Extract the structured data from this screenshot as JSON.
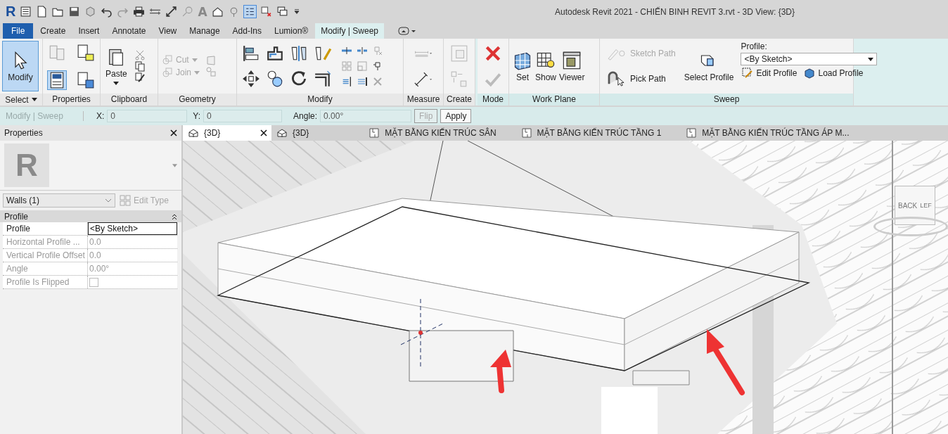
{
  "window": {
    "title": "Autodesk Revit 2021 - CHIẾN BINH REVIT 3.rvt - 3D View: {3D}"
  },
  "quick_access": {
    "logo": "R",
    "text_tool": "A"
  },
  "ribbon_tabs": [
    {
      "label": "File",
      "kind": "file",
      "selected": false
    },
    {
      "label": "Create",
      "kind": "tab",
      "selected": false
    },
    {
      "label": "Insert",
      "kind": "tab",
      "selected": false
    },
    {
      "label": "Annotate",
      "kind": "tab",
      "selected": false
    },
    {
      "label": "View",
      "kind": "tab",
      "selected": false
    },
    {
      "label": "Manage",
      "kind": "tab",
      "selected": false
    },
    {
      "label": "Add-Ins",
      "kind": "tab",
      "selected": false
    },
    {
      "label": "Lumion®",
      "kind": "tab",
      "selected": false
    },
    {
      "label": "Modify | Sweep",
      "kind": "context",
      "selected": true
    }
  ],
  "panels": [
    {
      "label": "Select",
      "tools": [
        {
          "label": "Modify",
          "selected": true
        }
      ]
    },
    {
      "label": "Properties"
    },
    {
      "label": "Clipboard",
      "tools": [
        {
          "label": "Paste"
        }
      ]
    },
    {
      "label": "Geometry",
      "tools": [
        {
          "label": "Cut",
          "disabled": true
        },
        {
          "label": "Join",
          "disabled": true
        }
      ]
    },
    {
      "label": "Modify"
    },
    {
      "label": "Measure"
    },
    {
      "label": "Create"
    },
    {
      "label": "Mode"
    },
    {
      "label": "Work Plane",
      "tools": [
        {
          "label": "Set"
        },
        {
          "label": "Show"
        },
        {
          "label": "Viewer"
        }
      ]
    },
    {
      "label": "Sweep",
      "tools": [
        {
          "label": "Sketch Path",
          "disabled": true
        },
        {
          "label": "Pick Path",
          "disabled": false
        },
        {
          "label": "Select Profile",
          "disabled": false
        },
        {
          "label": "Edit Profile",
          "disabled": false
        },
        {
          "label": "Load Profile",
          "disabled": false
        }
      ],
      "profile": {
        "label": "Profile:",
        "value": "<By Sketch>"
      }
    }
  ],
  "options_bar": {
    "context": "Modify | Sweep",
    "fields": [
      {
        "label": "X:",
        "value": "0"
      },
      {
        "label": "Y:",
        "value": "0"
      },
      {
        "label": "Angle:",
        "value": "0.00°"
      }
    ],
    "buttons": [
      {
        "label": "Flip",
        "disabled": true
      },
      {
        "label": "Apply",
        "disabled": false
      }
    ]
  },
  "properties": {
    "title": "Properties",
    "preview": "R",
    "type_selector": "Walls (1)",
    "edit_type": {
      "label": "Edit Type",
      "disabled": true
    },
    "section": "Profile",
    "rows": [
      {
        "name": "Profile",
        "value": "<By Sketch>",
        "kind": "text",
        "disabled": false
      },
      {
        "name": "Horizontal Profile ...",
        "value": "0.0",
        "kind": "text",
        "disabled": true
      },
      {
        "name": "Vertical Profile Offset",
        "value": "0.0",
        "kind": "text",
        "disabled": true
      },
      {
        "name": "Angle",
        "value": "0.00°",
        "kind": "text",
        "disabled": true
      },
      {
        "name": "Profile Is Flipped",
        "kind": "checkbox",
        "checked": false,
        "disabled": true
      }
    ]
  },
  "view_tabs": [
    {
      "label": "{3D}",
      "kind": "model",
      "selected": true
    },
    {
      "label": "{3D}",
      "kind": "model",
      "selected": false
    },
    {
      "label": "MẶT BẰNG KIẾN TRÚC SÂN",
      "kind": "plan",
      "selected": false
    },
    {
      "label": "MẶT BẰNG KIẾN TRÚC TẦNG 1",
      "kind": "plan",
      "selected": false
    },
    {
      "label": "MẶT BẰNG KIẾN TRÚC TẦNG ÁP M...",
      "kind": "plan",
      "selected": false
    }
  ],
  "viewcube": {
    "face_labels": [
      "BACK",
      "LEF"
    ]
  }
}
